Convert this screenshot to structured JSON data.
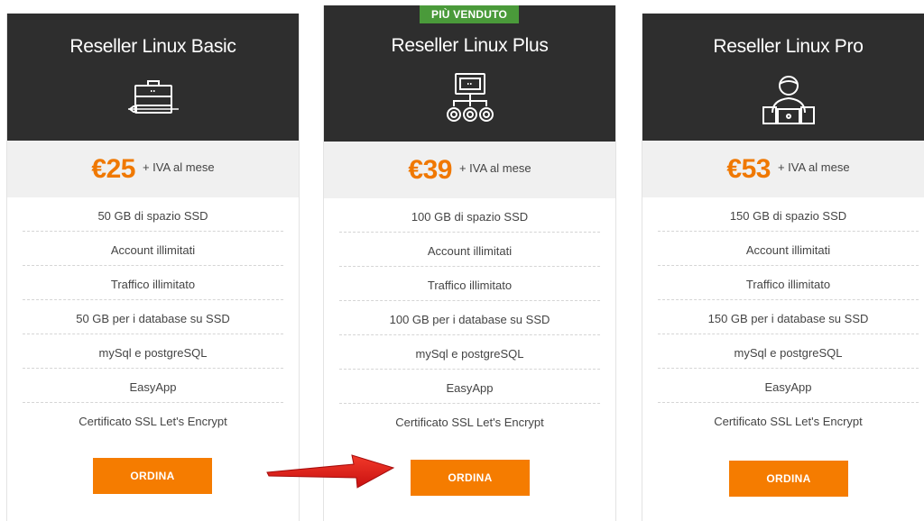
{
  "plans": [
    {
      "title": "Reseller Linux Basic",
      "icon": "briefcase-icon",
      "price": "€25",
      "price_suffix": "+ IVA al mese",
      "features": [
        "50 GB di spazio SSD",
        "Account illimitati",
        "Traffico illimitato",
        "50 GB per i database su SSD",
        "mySql e postgreSQL",
        "EasyApp",
        "Certificato SSL Let's Encrypt"
      ],
      "button": "ORDINA"
    },
    {
      "badge": "PIÙ VENDUTO",
      "title": "Reseller Linux Plus",
      "icon": "network-hierarchy-icon",
      "price": "€39",
      "price_suffix": "+ IVA al mese",
      "features": [
        "100 GB di spazio SSD",
        "Account illimitati",
        "Traffico illimitato",
        "100 GB per i database su SSD",
        "mySql e postgreSQL",
        "EasyApp",
        "Certificato SSL Let's Encrypt"
      ],
      "button": "ORDINA"
    },
    {
      "title": "Reseller Linux Pro",
      "icon": "user-laptop-icon",
      "price": "€53",
      "price_suffix": "+ IVA al mese",
      "features": [
        "150 GB di spazio SSD",
        "Account illimitati",
        "Traffico illimitato",
        "150 GB per i database su SSD",
        "mySql e postgreSQL",
        "EasyApp",
        "Certificato SSL Let's Encrypt"
      ],
      "button": "ORDINA"
    }
  ],
  "colors": {
    "header_bg": "#2e2e2e",
    "price_accent": "#f07800",
    "button_bg": "#f57c00",
    "badge_bg": "#4a9a3a",
    "arrow": "#e01e1e"
  },
  "annotation": {
    "icon": "red-arrow-icon"
  }
}
